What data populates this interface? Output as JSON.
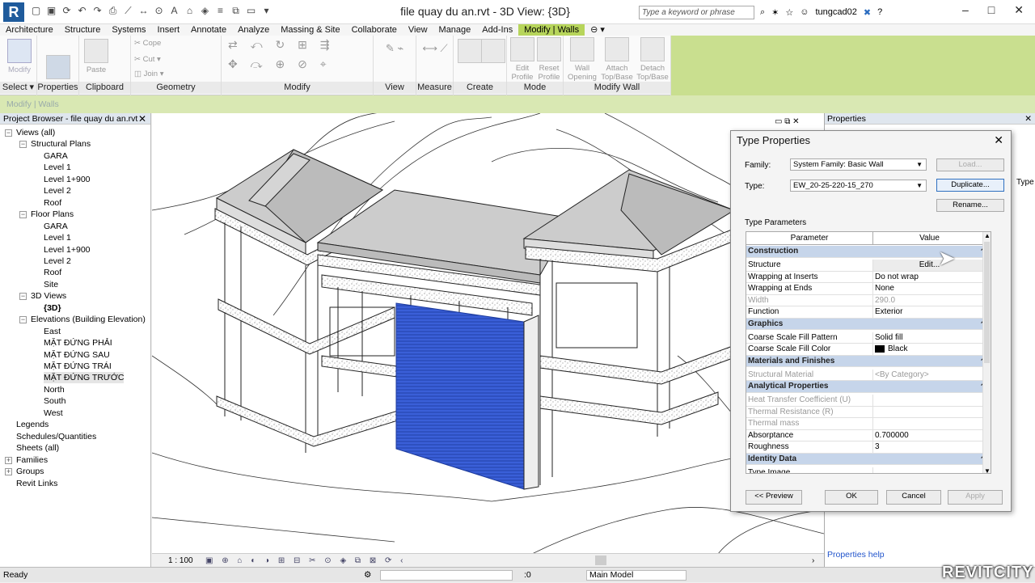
{
  "app": {
    "logo": "R",
    "window_title": "file quay du an.rvt - 3D View: {3D}",
    "search_placeholder": "Type a keyword or phrase",
    "user": "tungcad02"
  },
  "ribbon_tabs": [
    "Architecture",
    "Structure",
    "Systems",
    "Insert",
    "Annotate",
    "Analyze",
    "Massing & Site",
    "Collaborate",
    "View",
    "Manage",
    "Add-Ins",
    "Modify | Walls"
  ],
  "ribbon_panels": {
    "select": "Select",
    "properties": "Properties",
    "clipboard": "Clipboard",
    "geometry": "Geometry",
    "modify": "Modify",
    "view": "View",
    "measure": "Measure",
    "create": "Create",
    "mode": "Mode",
    "modify_wall": "Modify Wall"
  },
  "ribbon_buttons": {
    "modify": "Modify",
    "paste": "Paste",
    "copy": "Cope",
    "cut": "Cut",
    "join": "Join",
    "edit_profile": "Edit Profile",
    "reset_profile": "Reset Profile",
    "wall_opening": "Wall Opening",
    "attach": "Attach Top/Base",
    "detach": "Detach Top/Base"
  },
  "context_bar": "Modify | Walls",
  "project_browser": {
    "title": "Project Browser - file quay du an.rvt",
    "items": [
      {
        "label": "Views (all)",
        "level": 0,
        "toggle": "−"
      },
      {
        "label": "Structural Plans",
        "level": 1,
        "toggle": "−"
      },
      {
        "label": "GARA",
        "level": 2
      },
      {
        "label": "Level 1",
        "level": 2
      },
      {
        "label": "Level 1+900",
        "level": 2
      },
      {
        "label": "Level 2",
        "level": 2
      },
      {
        "label": "Roof",
        "level": 2
      },
      {
        "label": "Floor Plans",
        "level": 1,
        "toggle": "−"
      },
      {
        "label": "GARA",
        "level": 2
      },
      {
        "label": "Level 1",
        "level": 2
      },
      {
        "label": "Level 1+900",
        "level": 2
      },
      {
        "label": "Level 2",
        "level": 2
      },
      {
        "label": "Roof",
        "level": 2
      },
      {
        "label": "Site",
        "level": 2
      },
      {
        "label": "3D Views",
        "level": 1,
        "toggle": "−"
      },
      {
        "label": "{3D}",
        "level": 2
      },
      {
        "label": "Elevations (Building Elevation)",
        "level": 1,
        "toggle": "−"
      },
      {
        "label": "East",
        "level": 2
      },
      {
        "label": "MẶT ĐỨNG PHẢI",
        "level": 2
      },
      {
        "label": "MẶT ĐỨNG SAU",
        "level": 2
      },
      {
        "label": "MẶT ĐỨNG TRÁI",
        "level": 2
      },
      {
        "label": "MẶT ĐỨNG TRƯỚC",
        "level": 2
      },
      {
        "label": "North",
        "level": 2
      },
      {
        "label": "South",
        "level": 2
      },
      {
        "label": "West",
        "level": 2
      },
      {
        "label": "Legends",
        "level": 0
      },
      {
        "label": "Schedules/Quantities",
        "level": 0
      },
      {
        "label": "Sheets (all)",
        "level": 0
      },
      {
        "label": "Families",
        "level": 0,
        "toggle": "+"
      },
      {
        "label": "Groups",
        "level": 0,
        "toggle": "+"
      },
      {
        "label": "Revit Links",
        "level": 0
      }
    ]
  },
  "view_bar": {
    "scale": "1 : 100"
  },
  "properties_panel": {
    "title": "Properties",
    "help": "Properties help",
    "type_label": "Type"
  },
  "type_properties": {
    "title": "Type Properties",
    "family_label": "Family:",
    "family_value": "System Family: Basic Wall",
    "type_label": "Type:",
    "type_value": "EW_20-25-220-15_270",
    "load_btn": "Load...",
    "duplicate_btn": "Duplicate...",
    "rename_btn": "Rename...",
    "section_label": "Type Parameters",
    "col_param": "Parameter",
    "col_value": "Value",
    "rows": [
      {
        "section": "Construction"
      },
      {
        "name": "Structure",
        "value": "Edit...",
        "button": true
      },
      {
        "name": "Wrapping at Inserts",
        "value": "Do not wrap"
      },
      {
        "name": "Wrapping at Ends",
        "value": "None"
      },
      {
        "name": "Width",
        "value": "290.0",
        "dim": true
      },
      {
        "name": "Function",
        "value": "Exterior"
      },
      {
        "section": "Graphics"
      },
      {
        "name": "Coarse Scale Fill Pattern",
        "value": "Solid fill"
      },
      {
        "name": "Coarse Scale Fill Color",
        "value": "Black",
        "swatch": true
      },
      {
        "section": "Materials and Finishes"
      },
      {
        "name": "Structural Material",
        "value": "<By Category>",
        "dim": true
      },
      {
        "section": "Analytical Properties"
      },
      {
        "name": "Heat Transfer Coefficient (U)",
        "value": "",
        "dim": true
      },
      {
        "name": "Thermal Resistance (R)",
        "value": "",
        "dim": true
      },
      {
        "name": "Thermal mass",
        "value": "",
        "dim": true
      },
      {
        "name": "Absorptance",
        "value": "0.700000"
      },
      {
        "name": "Roughness",
        "value": "3"
      },
      {
        "section": "Identity Data"
      },
      {
        "name": "Type Image",
        "value": ""
      }
    ],
    "preview_btn": "<< Preview",
    "ok_btn": "OK",
    "cancel_btn": "Cancel",
    "apply_btn": "Apply"
  },
  "status": {
    "text": "Ready",
    "filter": ":0",
    "workset": "Main Model"
  },
  "watermark": "REVITCITY",
  "colors": {
    "ribbon_active": "#b7d55b",
    "context_bar": "#d9e8b3",
    "selection": "#3a5fd8",
    "section_header": "#c6d5ea"
  }
}
